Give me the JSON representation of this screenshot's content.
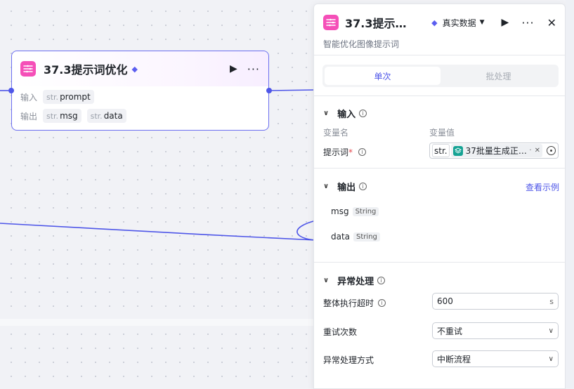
{
  "node": {
    "title": "37.3提示词优化",
    "input_label": "输入",
    "output_label": "输出",
    "inputs": [
      {
        "type": "str.",
        "name": "prompt"
      }
    ],
    "outputs": [
      {
        "type": "str.",
        "name": "msg"
      },
      {
        "type": "str.",
        "name": "data"
      }
    ]
  },
  "panel": {
    "title": "37.3提示…",
    "data_mode": "真实数据",
    "description": "智能优化图像提示词",
    "tabs": [
      {
        "label": "单次",
        "active": true
      },
      {
        "label": "批处理",
        "active": false
      }
    ],
    "input_section": {
      "title": "输入",
      "col_name": "变量名",
      "col_value": "变量值",
      "field_label": "提示词",
      "required_mark": "*",
      "value_type": "str.",
      "ref_text": "37批量生成正…",
      "ref_tail": "·"
    },
    "output_section": {
      "title": "输出",
      "example_link": "查看示例",
      "items": [
        {
          "name": "msg",
          "type": "String"
        },
        {
          "name": "data",
          "type": "String"
        }
      ]
    },
    "error_section": {
      "title": "异常处理",
      "timeout_label": "整体执行超时",
      "timeout_value": "600",
      "timeout_unit": "s",
      "retry_label": "重试次数",
      "retry_value": "不重试",
      "method_label": "异常处理方式",
      "method_value": "中断流程"
    }
  },
  "colors": {
    "accent": "#4e56e8",
    "app_icon": "#f54fb8",
    "ref_icon": "#16a394",
    "required": "#e5484d"
  }
}
